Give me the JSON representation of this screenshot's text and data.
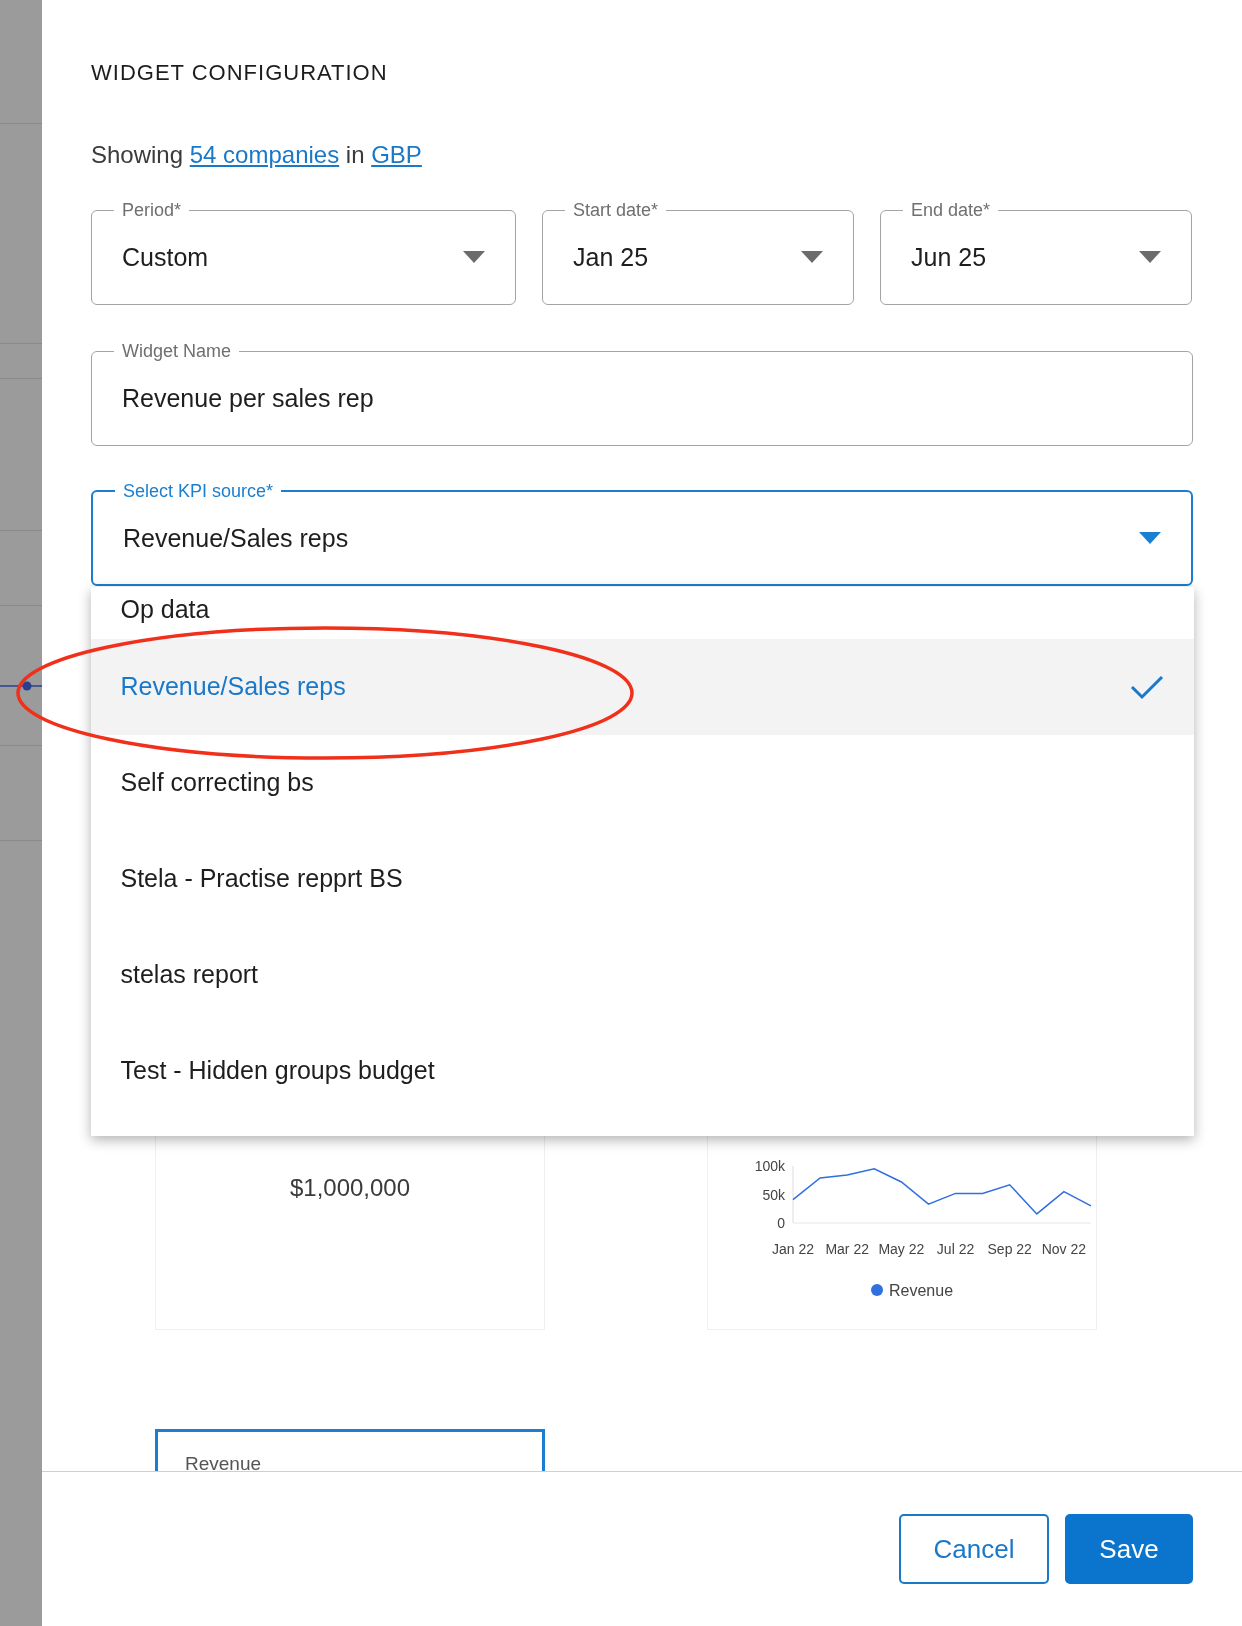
{
  "panel": {
    "title": "WIDGET CONFIGURATION"
  },
  "summary": {
    "lead": "Showing",
    "companies_link": "54 companies",
    "middle": "in",
    "currency_link": "GBP"
  },
  "filters": [
    {
      "label": "Period*",
      "value": "Custom"
    },
    {
      "label": "Start date*",
      "value": "Jan 25"
    },
    {
      "label": "End date*",
      "value": "Jun 25"
    }
  ],
  "widget_name": {
    "label": "Widget Name",
    "value": "Revenue per sales rep"
  },
  "kpi_source": {
    "label": "Select KPI source*",
    "value": "Revenue/Sales reps",
    "focused": true,
    "expanded": true,
    "options": [
      {
        "label": "Op data",
        "selected": false
      },
      {
        "label": "Revenue/Sales reps",
        "selected": true
      },
      {
        "label": "Self correcting bs",
        "selected": false
      },
      {
        "label": "Stela - Practise repprt BS",
        "selected": false
      },
      {
        "label": "stelas report",
        "selected": false
      },
      {
        "label": "Test - Hidden groups budget",
        "selected": false
      }
    ]
  },
  "cards": [
    {
      "kind": "metric",
      "value": "$1,000,000",
      "selected": false
    },
    {
      "kind": "chart",
      "selected": false,
      "chart_data": {
        "type": "line",
        "categories": [
          "Jan 22",
          null,
          "Mar 22",
          null,
          "May 22",
          null,
          "Jul 22",
          null,
          "Sep 22",
          null,
          "Nov 22",
          null
        ],
        "ylim": [
          0,
          100000
        ],
        "yticks": [
          {
            "value": 0,
            "label": "0"
          },
          {
            "value": 50000,
            "label": "50k"
          },
          {
            "value": 100000,
            "label": "100k"
          }
        ],
        "series": [
          {
            "name": "Revenue",
            "color": "#2f6fe0",
            "values": [
              41000,
              79000,
              84000,
              95000,
              72000,
              33000,
              52000,
              52000,
              67000,
              16000,
              55000,
              30000
            ]
          }
        ]
      }
    },
    {
      "kind": "title",
      "title": "Revenue",
      "selected": true
    }
  ],
  "buttons": [
    {
      "label": "Cancel",
      "kind": "secondary"
    },
    {
      "label": "Save",
      "kind": "primary"
    }
  ]
}
